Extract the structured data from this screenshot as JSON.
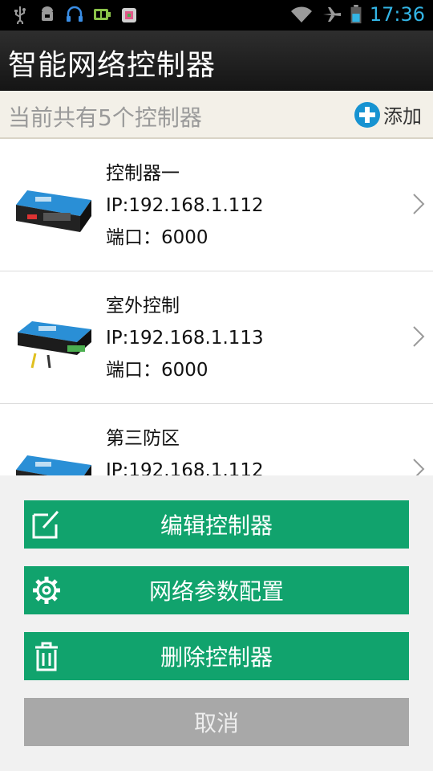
{
  "status_bar": {
    "time": "17:36",
    "left_icons": [
      "usb-icon",
      "android-debug-icon",
      "headset-icon",
      "battery-app-icon",
      "app-store-icon"
    ],
    "right_icons": [
      "wifi-icon",
      "airplane-icon",
      "battery-icon"
    ]
  },
  "app_bar": {
    "title": "智能网络控制器"
  },
  "subheader": {
    "count_text": "当前共有5个控制器",
    "add_label": "添加"
  },
  "controllers": [
    {
      "name": "控制器一",
      "ip": "IP:192.168.1.112",
      "port": "端口：6000"
    },
    {
      "name": "室外控制",
      "ip": "IP:192.168.1.113",
      "port": "端口：6000"
    },
    {
      "name": "第三防区",
      "ip": "IP:192.168.1.112",
      "port": ""
    }
  ],
  "action_sheet": {
    "edit_label": "编辑控制器",
    "network_label": "网络参数配置",
    "delete_label": "删除控制器",
    "cancel_label": "取消"
  },
  "colors": {
    "accent_green": "#11a36d",
    "status_blue": "#33b5e5",
    "cancel_gray": "#a8a8a8"
  }
}
